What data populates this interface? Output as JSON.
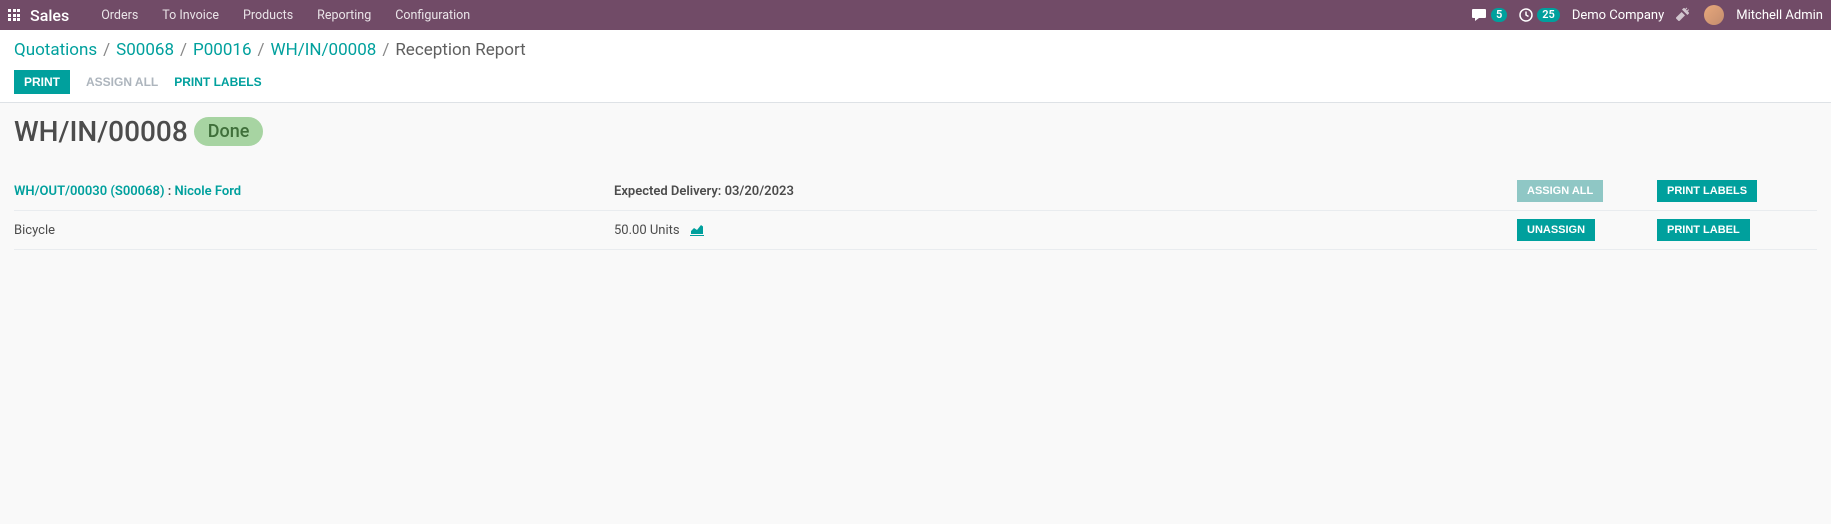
{
  "nav": {
    "brand": "Sales",
    "items": [
      "Orders",
      "To Invoice",
      "Products",
      "Reporting",
      "Configuration"
    ],
    "chat_count": "5",
    "clock_count": "25",
    "company": "Demo Company",
    "user": "Mitchell Admin"
  },
  "breadcrumb": {
    "items": [
      "Quotations",
      "S00068",
      "P00016",
      "WH/IN/00008"
    ],
    "current": "Reception Report"
  },
  "actions": {
    "print": "PRINT",
    "assign_all": "ASSIGN ALL",
    "print_labels": "PRINT LABELS"
  },
  "header": {
    "title": "WH/IN/00008",
    "status": "Done"
  },
  "order": {
    "ref": "WH/OUT/00030 (S00068)",
    "sep": " : ",
    "customer": "Nicole Ford",
    "expected_label": "Expected Delivery: ",
    "expected_date": "03/20/2023",
    "assign_all_btn": "ASSIGN ALL",
    "print_labels_btn": "PRINT LABELS"
  },
  "line": {
    "product": "Bicycle",
    "qty": "50.00 Units",
    "unassign_btn": "UNASSIGN",
    "print_label_btn": "PRINT LABEL"
  }
}
